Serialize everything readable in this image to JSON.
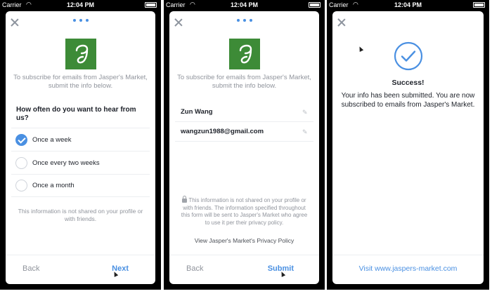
{
  "status_bar": {
    "carrier": "Carrier",
    "time": "12:04 PM"
  },
  "intro_text": "To subscribe for emails from Jasper's Market, submit the info below.",
  "logo_letter": "g",
  "screen1": {
    "question": "How often do you want to hear from us?",
    "options": [
      {
        "label": "Once a week",
        "selected": true
      },
      {
        "label": "Once every two weeks",
        "selected": false
      },
      {
        "label": "Once a month",
        "selected": false
      }
    ],
    "note": "This information is not shared on your profile or with friends.",
    "back_label": "Back",
    "next_label": "Next"
  },
  "screen2": {
    "name_value": "Zun Wang",
    "email_value": "wangzun1988@gmail.com",
    "privacy_note": "This information is not shared on your profile or with friends. The information specified throughout this form will be sent to Jasper's Market who agree to use it per their privacy policy.",
    "policy_link": "View Jasper's Market's Privacy Policy",
    "back_label": "Back",
    "submit_label": "Submit"
  },
  "screen3": {
    "title": "Success!",
    "message": "Your info has been submitted. You are now subscribed to emails from Jasper's Market.",
    "visit_link": "Visit www.jaspers-market.com"
  },
  "colors": {
    "accent": "#4a90e2",
    "logo_green": "#3d8b37",
    "muted_text": "#90949c"
  }
}
